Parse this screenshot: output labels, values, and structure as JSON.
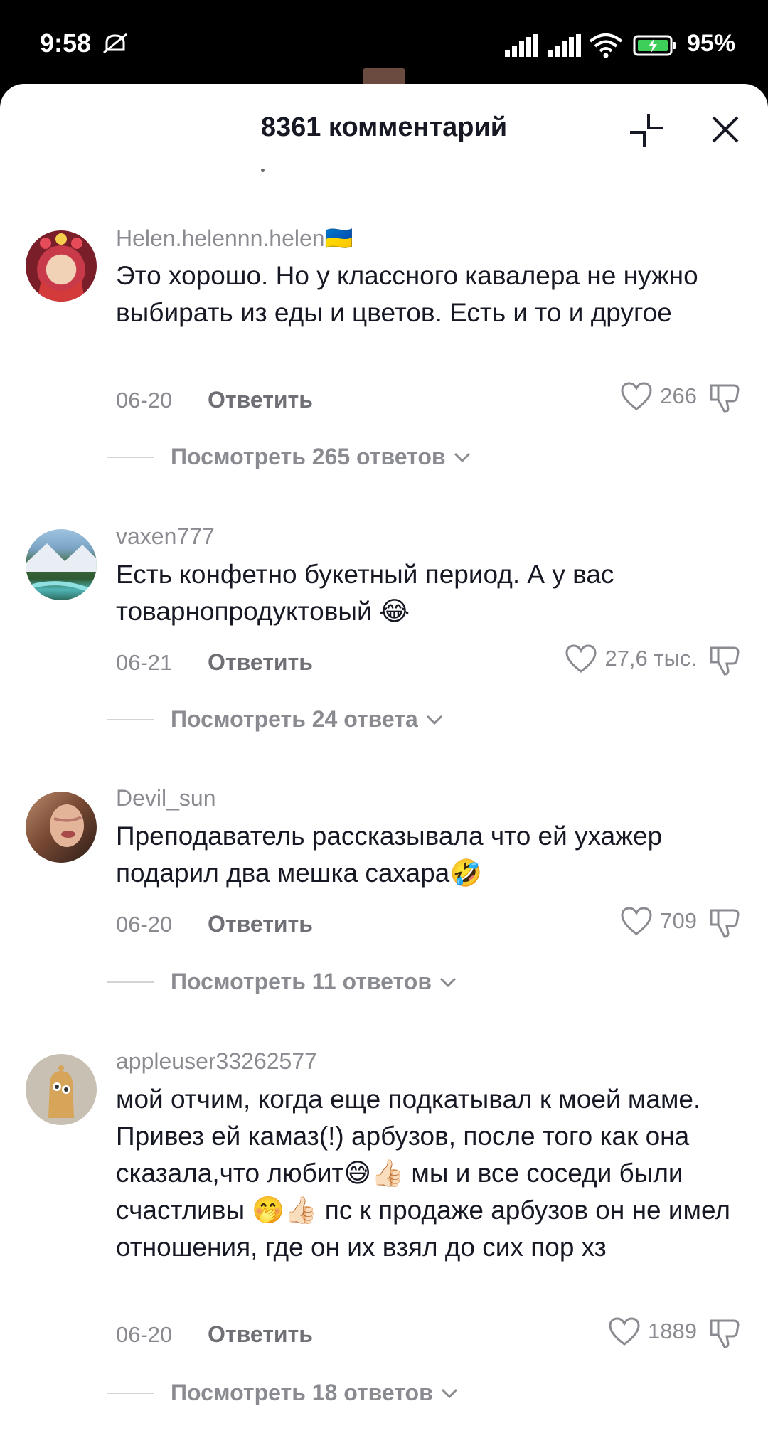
{
  "status_bar": {
    "time": "9:58",
    "battery": "95%"
  },
  "sheet": {
    "title": "8361 комментарий"
  },
  "comments": [
    {
      "username": "Helen.helennn.helen🇺🇦",
      "text": "Это хорошо. Но у классного кавалера не нужно выбирать из еды и цветов. Есть и то и другое",
      "date": "06-20",
      "reply": "Ответить",
      "likes": "266",
      "replies": "Посмотреть 265 ответов"
    },
    {
      "username": "vaxen777",
      "text": "Есть конфетно букетный период. А у вас товарнопродуктовый 😂",
      "date": "06-21",
      "reply": "Ответить",
      "likes": "27,6 тыс.",
      "replies": "Посмотреть 24 ответа"
    },
    {
      "username": "Devil_sun",
      "text": "Преподаватель рассказывала что ей ухажер подарил два мешка сахара🤣",
      "date": "06-20",
      "reply": "Ответить",
      "likes": "709",
      "replies": "Посмотреть 11 ответов"
    },
    {
      "username": "appleuser33262577",
      "text": "мой отчим, когда еще подкатывал к моей маме. Привез ей камаз(!) арбузов, после того как она сказала,что любит😅👍🏻 мы и все соседи были счастливы 🤭👍🏻 пс к продаже арбузов он не имел отношения, где он их взял до сих пор хз",
      "date": "06-20",
      "reply": "Ответить",
      "likes": "1889",
      "replies": "Посмотреть 18 ответов"
    }
  ]
}
